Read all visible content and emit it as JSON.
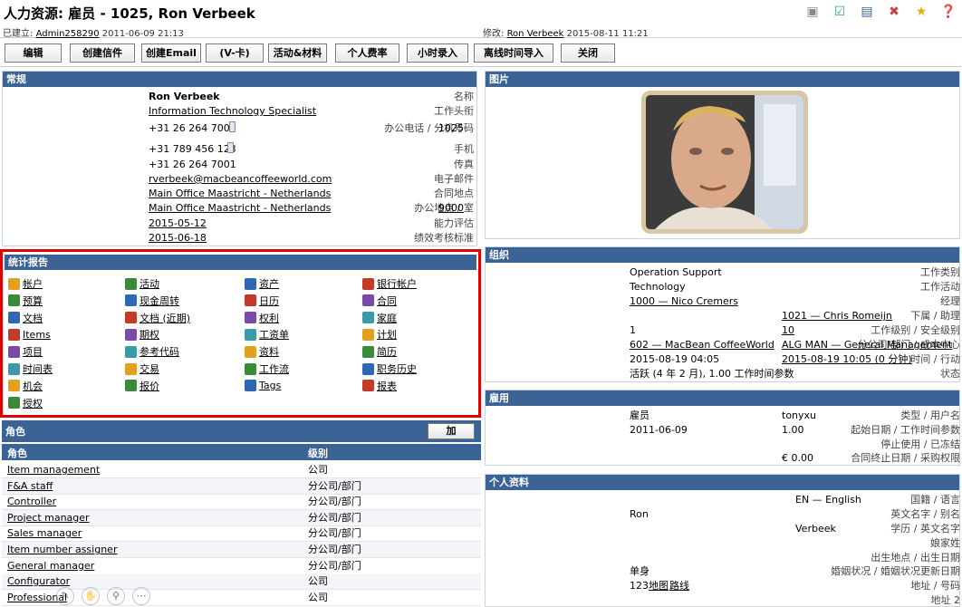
{
  "title": "人力资源: 雇员 - 1025, Ron Verbeek",
  "meta": {
    "created_label": "已建立:",
    "created_by": "Admin258290",
    "created_at": "2011-06-09 21:13",
    "modified_label": "修改:",
    "modified_by": "Ron Verbeek",
    "modified_at": "2015-08-11 11:21"
  },
  "toolbar": [
    "编辑",
    "创建信件",
    "创建Email",
    "(V-卡)",
    "活动&材料",
    "个人费率",
    "小时录入",
    "离线时间导入",
    "关闭"
  ],
  "general": {
    "header": "常规",
    "fields": [
      {
        "label": "名称",
        "value": "Ron Verbeek",
        "bold": true
      },
      {
        "label": "工作头衔",
        "value": "Information Technology Specialist",
        "link": true
      },
      {
        "label": "办公电话 / 分机号码",
        "value": "+31 26 264 7000",
        "extra": "1025",
        "phone": true
      },
      {
        "label": "手机",
        "value": "+31 789 456 123",
        "phone": true
      },
      {
        "label": "传真",
        "value": "+31 26 264 7001"
      },
      {
        "label": "电子邮件",
        "value": "rverbeek@macbeancoffeeworld.com",
        "link": true
      },
      {
        "label": "合同地点",
        "value": "Main Office Maastricht - Netherlands",
        "link": true
      },
      {
        "label": "办公地点 / 室",
        "value": "Main Office Maastricht - Netherlands",
        "link": true,
        "extra": "9000",
        "extra_link": true
      },
      {
        "label": "能力评估",
        "value": "2015-05-12",
        "link": true
      },
      {
        "label": "绩效考核标准",
        "value": "2015-06-18",
        "link": true
      }
    ]
  },
  "stats": {
    "header": "统计报告",
    "items": [
      [
        "帐户",
        "活动",
        "资产",
        "银行帐户"
      ],
      [
        "预算",
        "现金周转",
        "日历",
        "合同"
      ],
      [
        "文档",
        "文档 (近期)",
        "权利",
        "家庭"
      ],
      [
        "Items",
        "期权",
        "工资单",
        "计划"
      ],
      [
        "项目",
        "参考代码",
        "资料",
        "简历"
      ],
      [
        "时间表",
        "交易",
        "工作流",
        "职务历史"
      ],
      [
        "机会",
        "报价",
        "Tags",
        "报表"
      ],
      [
        "授权"
      ]
    ]
  },
  "roles": {
    "header": "角色",
    "add_label": "加",
    "col_role": "角色",
    "col_level": "级别",
    "rows": [
      {
        "name": "Item management",
        "level": "公司"
      },
      {
        "name": "F&A staff",
        "level": "分公司/部门"
      },
      {
        "name": "Controller",
        "level": "分公司/部门"
      },
      {
        "name": "Project manager",
        "level": "分公司/部门"
      },
      {
        "name": "Sales manager",
        "level": "分公司/部门"
      },
      {
        "name": "Item number assigner",
        "level": "分公司/部门"
      },
      {
        "name": "General manager",
        "level": "分公司/部门"
      },
      {
        "name": "Configurator",
        "level": "公司"
      },
      {
        "name": "Professional",
        "level": "公司"
      }
    ]
  },
  "picture": {
    "header": "图片"
  },
  "org": {
    "header": "组织",
    "fields": [
      {
        "label": "工作类别",
        "value": "Operation Support"
      },
      {
        "label": "工作活动",
        "value": "Technology"
      },
      {
        "label": "经理",
        "value": "1000 — Nico Cremers",
        "link": true
      },
      {
        "label": "下属 / 助理",
        "value": "",
        "extra": "1021 — Chris Romeijn"
      },
      {
        "label": "工作级别 / 安全级别",
        "value": "1",
        "extra": "10"
      },
      {
        "label": "分公司/部门 / 成本中心",
        "value": "602 — MacBean CoffeeWorld",
        "link": true,
        "extra": "ALG MAN — General Management"
      },
      {
        "label": "时间 / 行动",
        "value": "2015-08-19 04:05",
        "extra": "2015-08-19 10:05 (0 分钟)"
      },
      {
        "label": "状态",
        "value": "活跃 (4 年 2 月), 1.00 工作时间参数"
      }
    ]
  },
  "employment": {
    "header": "雇用",
    "fields": [
      {
        "label": "类型 / 用户名",
        "value": "雇员",
        "extra": "tonyxu"
      },
      {
        "label": "起始日期 / 工作时间参数",
        "value": "2011-06-09",
        "extra": "1.00"
      },
      {
        "label": "停止使用 / 已冻结",
        "value": ""
      },
      {
        "label": "合同终止日期 / 采购权限",
        "value": "",
        "extra": "€ 0.00"
      }
    ]
  },
  "personal": {
    "header": "个人资料",
    "fields": [
      {
        "label": "国籍 / 语言",
        "value": "",
        "extra": "EN — English"
      },
      {
        "label": "英文名字 / 别名",
        "value": "Ron"
      },
      {
        "label": "学历 / 英文名字",
        "value": "",
        "extra": "Verbeek"
      },
      {
        "label": "娘家姓",
        "value": ""
      },
      {
        "label": "出生地点 / 出生日期",
        "value": ""
      },
      {
        "label": "婚姻状况 / 婚姻状况更新日期",
        "value": "单身"
      },
      {
        "label": "地址 / 号码",
        "value": "123",
        "map": "地图",
        "route": "路线"
      },
      {
        "label": "地址 2",
        "value": ""
      }
    ]
  }
}
